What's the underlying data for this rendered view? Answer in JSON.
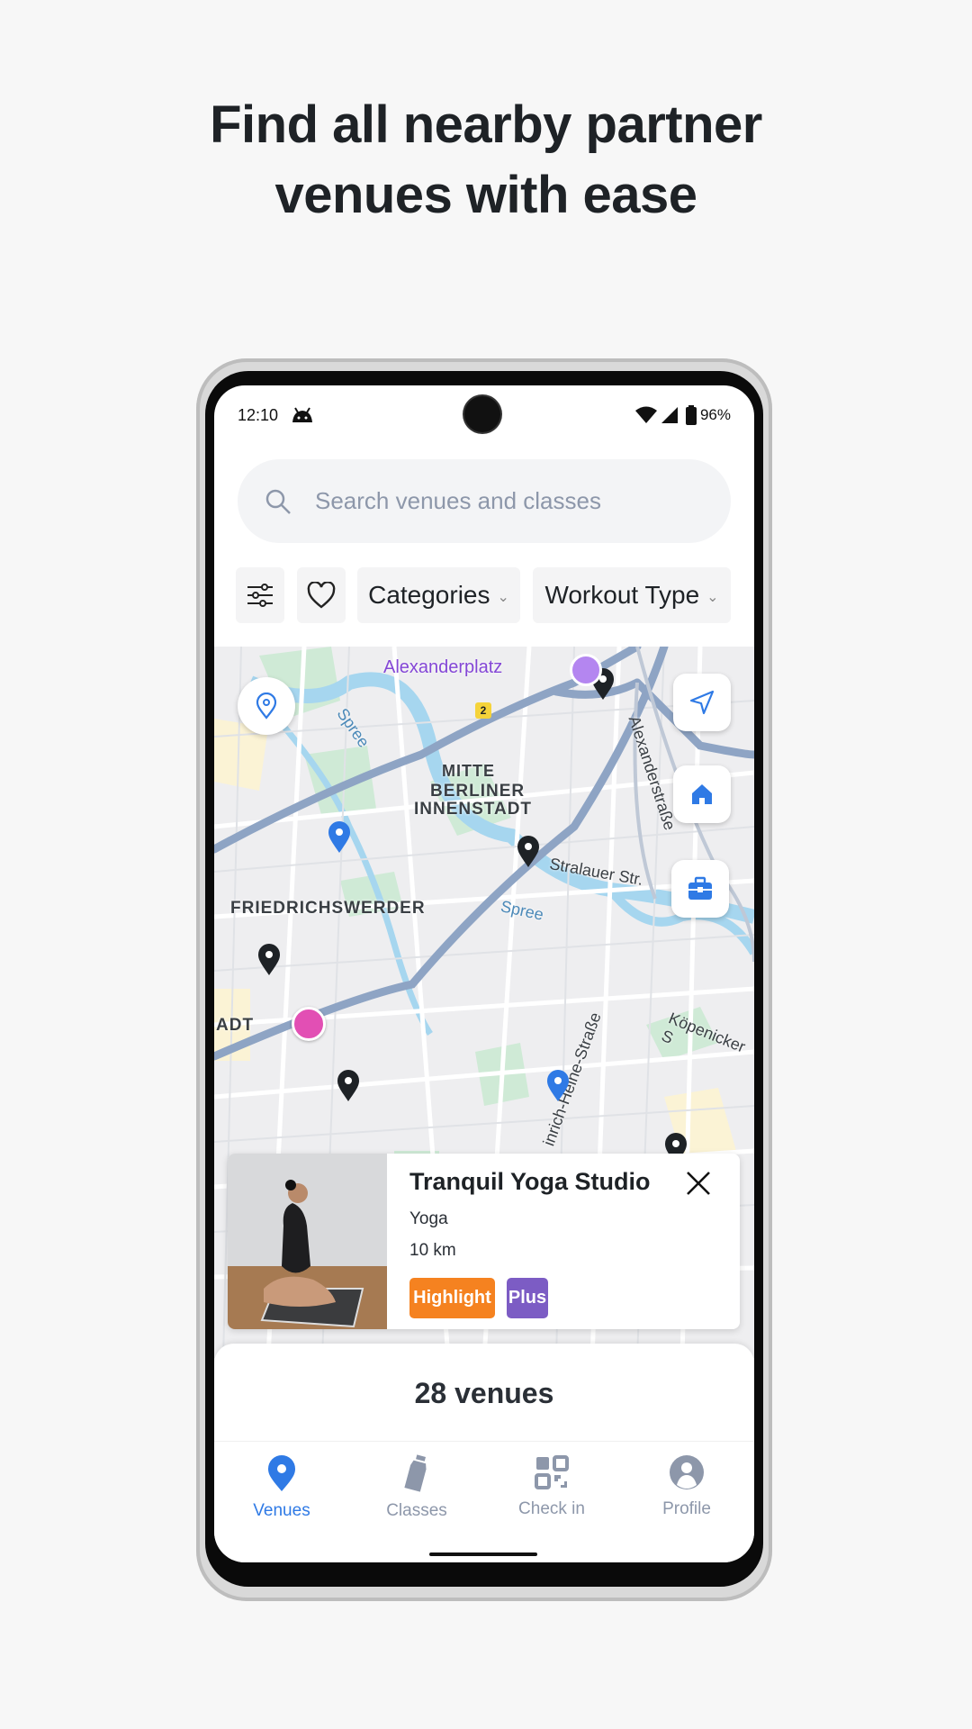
{
  "headline": {
    "line1": "Find all nearby partner",
    "line2": "venues with ease"
  },
  "status_bar": {
    "time": "12:10",
    "battery": "96%",
    "icons": [
      "android-icon",
      "wifi-icon",
      "signal-icon",
      "battery-icon"
    ]
  },
  "search": {
    "placeholder": "Search venues and classes",
    "icon": "search-icon"
  },
  "filters": {
    "filter_icon": "sliders-icon",
    "favorite_icon": "heart-icon",
    "categories": "Categories",
    "workout_type": "Workout Type"
  },
  "map": {
    "labels": {
      "alexanderplatz": "Alexanderplatz",
      "mitte": "MITTE",
      "berliner": "BERLINER",
      "innenstadt": "INNENSTADT",
      "friedrichswerder": "FRIEDRICHSWERDER",
      "stralauer": "Stralauer Str.",
      "spree1": "Spree",
      "spree2": "Spree",
      "alexanderstrasse": "Alexanderstraße",
      "koepenicker": "Köpenicker S",
      "heine": "inrich-Heine-Straße",
      "adt": "ADT",
      "route": "2"
    },
    "buttons": [
      "location-pin-icon",
      "navigation-arrow-icon",
      "home-icon",
      "briefcase-icon"
    ]
  },
  "venue_card": {
    "name": "Tranquil Yoga Studio",
    "category": "Yoga",
    "distance": "10 km",
    "badges": [
      {
        "label": "Highlight",
        "color": "#f58220"
      },
      {
        "label": "Plus",
        "color": "#7c5cc4"
      }
    ]
  },
  "results": {
    "count_label": "28 venues"
  },
  "bottom_nav": {
    "items": [
      {
        "label": "Venues",
        "icon": "location-pin-icon",
        "active": true
      },
      {
        "label": "Classes",
        "icon": "bottle-icon",
        "active": false
      },
      {
        "label": "Check in",
        "icon": "qr-code-icon",
        "active": false
      },
      {
        "label": "Profile",
        "icon": "profile-icon",
        "active": false
      }
    ]
  },
  "colors": {
    "accent": "#2f7ae5",
    "inactive": "#8d97aa",
    "highlight": "#f58220",
    "plus": "#7c5cc4"
  }
}
